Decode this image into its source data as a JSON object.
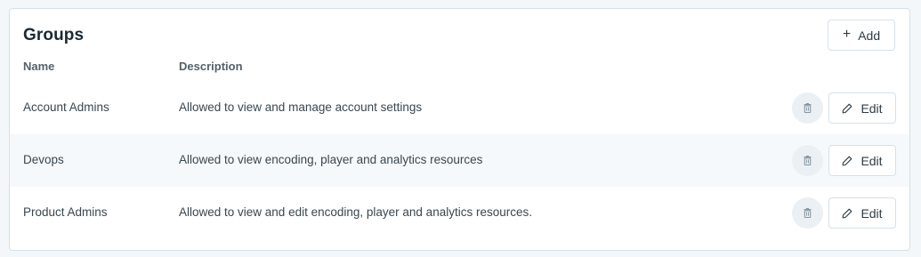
{
  "groups_card": {
    "title": "Groups",
    "add_button": {
      "label": "Add",
      "icon": "plus-icon"
    },
    "columns": {
      "name": "Name",
      "description": "Description"
    },
    "rows": [
      {
        "name": "Account Admins",
        "description": "Allowed to view and manage account settings",
        "edit_label": "Edit",
        "delete_icon": "trash-icon",
        "edit_icon": "pencil-icon"
      },
      {
        "name": "Devops",
        "description": "Allowed to view encoding, player and analytics resources",
        "edit_label": "Edit",
        "delete_icon": "trash-icon",
        "edit_icon": "pencil-icon"
      },
      {
        "name": "Product Admins",
        "description": "Allowed to view and edit encoding, player and analytics resources.",
        "edit_label": "Edit",
        "delete_icon": "trash-icon",
        "edit_icon": "pencil-icon"
      }
    ]
  },
  "colors": {
    "page_background": "#f3f7f9",
    "card_background": "#ffffff",
    "border": "#d5e1e8",
    "alt_row": "#f6f9fb",
    "delete_button_bg": "#eaf0f4",
    "text_primary": "#1b2a33"
  }
}
